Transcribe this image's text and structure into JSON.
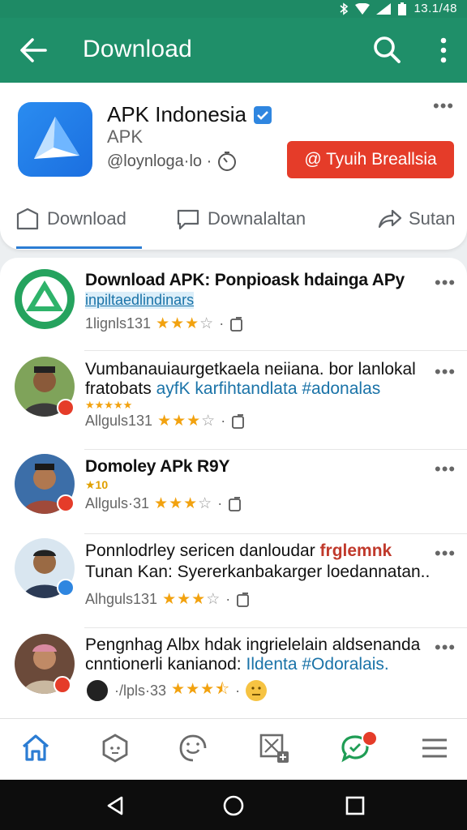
{
  "status": {
    "time": "13.1/48"
  },
  "appbar": {
    "title": "Download"
  },
  "app": {
    "name": "APK Indonesia",
    "subtitle": "APK",
    "developer": "@loynloga·lo ·",
    "install_label": "@ Tyuih Breallsia"
  },
  "tabs": [
    {
      "label": "Download"
    },
    {
      "label": "Downalaltan"
    },
    {
      "label": "Sutan"
    }
  ],
  "feed": [
    {
      "title": "Download APK: Ponpioask hdainga APy",
      "subline": "inpiltaedlindinars",
      "meta": "1lignls131",
      "stars": 3
    },
    {
      "title": "Vumbanauiaurgetkaela neiiana. bor lanlokal",
      "line2_text": "fratobats",
      "line2_link": "ayfK karfihtandlata #adonalas",
      "rating_row": "★★★★★",
      "meta": "Allguls131",
      "stars": 3
    },
    {
      "title": "Domoley APk R9Y",
      "rating_row": "★10",
      "meta": "Allguls·31",
      "stars": 3
    },
    {
      "title_text": "Ponnlodrley sericen danloudar",
      "title_hl": "frglemnk",
      "line2": "Tunan Kan: Syererkanbakarger loedannatan..",
      "meta": "Alhguls131",
      "stars": 3
    },
    {
      "title": "Pengnhag Albx hdak ingrielelain aldsenanda",
      "line2_text": "cnntionerli kanianod:",
      "line2_link": "Ildenta #Odoralais.",
      "meta": "·/lpls·33",
      "stars": 3.5
    }
  ],
  "colors": {
    "appbar": "#1f8f69",
    "install": "#e53c29",
    "star": "#f2a20f",
    "link": "#1a73a8",
    "tab_indicator": "#2b7cd3"
  },
  "icons": [
    "back-arrow-icon",
    "search-icon",
    "more-vert-icon",
    "verified-icon",
    "timer-icon",
    "home-icon",
    "hexagon-icon",
    "smiley-icon",
    "image-x-icon",
    "chat-icon",
    "menu-icon"
  ]
}
